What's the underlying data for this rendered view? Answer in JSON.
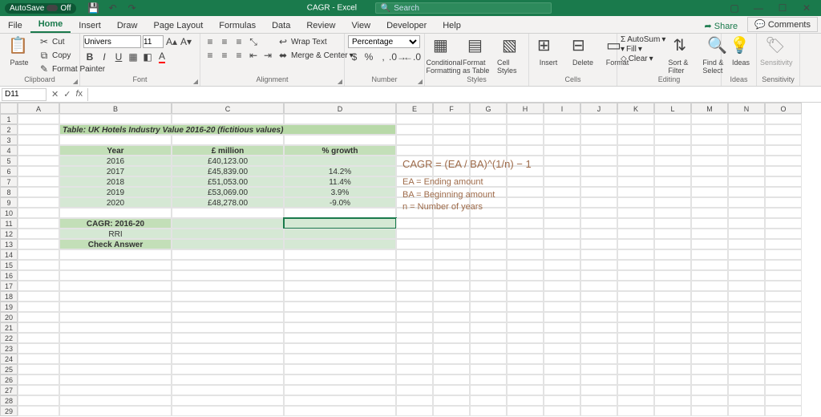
{
  "titlebar": {
    "autosave_label": "AutoSave",
    "autosave_state": "Off",
    "doc_title": "CAGR - Excel",
    "search_placeholder": "Search"
  },
  "tabs": {
    "file": "File",
    "home": "Home",
    "insert": "Insert",
    "draw": "Draw",
    "pagelayout": "Page Layout",
    "formulas": "Formulas",
    "data": "Data",
    "review": "Review",
    "view": "View",
    "developer": "Developer",
    "help": "Help",
    "share": "Share",
    "comments": "Comments"
  },
  "ribbon": {
    "clipboard": {
      "cut": "Cut",
      "copy": "Copy",
      "format_painter": "Format Painter",
      "label": "Clipboard"
    },
    "font": {
      "name": "Univers",
      "size": "11",
      "label": "Font"
    },
    "alignment": {
      "wrap": "Wrap Text",
      "merge": "Merge & Center",
      "label": "Alignment"
    },
    "number": {
      "format": "Percentage",
      "label": "Number"
    },
    "styles": {
      "cond": "Conditional Formatting",
      "fmttbl": "Format as Table",
      "cellsty": "Cell Styles",
      "label": "Styles"
    },
    "cells": {
      "insert": "Insert",
      "delete": "Delete",
      "format": "Format",
      "label": "Cells"
    },
    "editing": {
      "autosum": "AutoSum",
      "fill": "Fill",
      "clear": "Clear",
      "sort": "Sort & Filter",
      "find": "Find & Select",
      "label": "Editing"
    },
    "ideas": {
      "ideas": "Ideas",
      "label": "Ideas"
    },
    "sens": {
      "sens": "Sensitivity",
      "label": "Sensitivity"
    }
  },
  "namebox": {
    "cell": "D11"
  },
  "cols": [
    "A",
    "B",
    "C",
    "D",
    "E",
    "F",
    "G",
    "H",
    "I",
    "J",
    "K",
    "L",
    "M",
    "N",
    "O"
  ],
  "table": {
    "title": "Table: UK Hotels Industry Value 2016-20 (fictitious values)",
    "hdr_year": "Year",
    "hdr_val": "£ million",
    "hdr_growth": "% growth",
    "rows": [
      {
        "y": "2016",
        "v": "£40,123.00",
        "g": ""
      },
      {
        "y": "2017",
        "v": "£45,839.00",
        "g": "14.2%"
      },
      {
        "y": "2018",
        "v": "£51,053.00",
        "g": "11.4%"
      },
      {
        "y": "2019",
        "v": "£53,069.00",
        "g": "3.9%"
      },
      {
        "y": "2020",
        "v": "£48,278.00",
        "g": "-9.0%"
      }
    ],
    "cagr_label": "CAGR: 2016-20",
    "rri_label": "RRI",
    "check_label": "Check Answer"
  },
  "formula": {
    "eq": "CAGR = (EA / BA)^(1/n) − 1",
    "ea": "EA = Ending amount",
    "ba": "BA = Beginning amount",
    "n": "n = Number of years"
  },
  "chart_data": {
    "type": "table",
    "title": "UK Hotels Industry Value 2016-20 (fictitious values)",
    "columns": [
      "Year",
      "£ million",
      "% growth"
    ],
    "rows": [
      [
        2016,
        40123.0,
        null
      ],
      [
        2017,
        45839.0,
        14.2
      ],
      [
        2018,
        51053.0,
        11.4
      ],
      [
        2019,
        53069.0,
        3.9
      ],
      [
        2020,
        48278.0,
        -9.0
      ]
    ],
    "derived_labels": [
      "CAGR: 2016-20",
      "RRI",
      "Check Answer"
    ]
  }
}
